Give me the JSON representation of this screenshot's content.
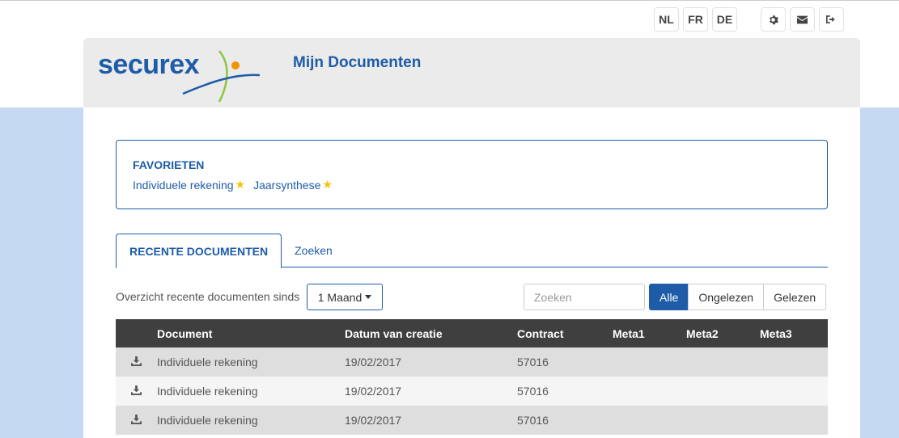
{
  "languages": [
    "NL",
    "FR",
    "DE"
  ],
  "icons": {
    "settings": "gear-icon",
    "mail": "envelope-icon",
    "logout": "sign-out-icon",
    "download": "download-icon",
    "star": "star-icon"
  },
  "colors": {
    "brand_blue": "#1e5ca8",
    "logo_orange": "#f39200",
    "logo_green": "#8dc63f",
    "star": "#f5c400",
    "table_header": "#3f3f3f",
    "page_bg": "#c5d9f3"
  },
  "header": {
    "logo_text": "securex",
    "title": "Mijn Documenten"
  },
  "favorites": {
    "title": "FAVORIETEN",
    "links": [
      {
        "label": "Individuele rekening"
      },
      {
        "label": "Jaarsynthese"
      }
    ]
  },
  "tabs": [
    {
      "label": "RECENTE DOCUMENTEN",
      "active": true
    },
    {
      "label": "Zoeken",
      "active": false
    }
  ],
  "filter": {
    "label": "Overzicht recente documenten sinds",
    "period": "1 Maand",
    "search_placeholder": "Zoeken",
    "read_filters": [
      "Alle",
      "Ongelezen",
      "Gelezen"
    ],
    "active_read_filter": "Alle"
  },
  "table": {
    "columns": [
      "Document",
      "Datum van creatie",
      "Contract",
      "Meta1",
      "Meta2",
      "Meta3"
    ],
    "rows": [
      {
        "document": "Individuele rekening",
        "date": "19/02/2017",
        "contract": "57016",
        "meta1": "",
        "meta2": "",
        "meta3": ""
      },
      {
        "document": "Individuele rekening",
        "date": "19/02/2017",
        "contract": "57016",
        "meta1": "",
        "meta2": "",
        "meta3": ""
      },
      {
        "document": "Individuele rekening",
        "date": "19/02/2017",
        "contract": "57016",
        "meta1": "",
        "meta2": "",
        "meta3": ""
      }
    ]
  }
}
